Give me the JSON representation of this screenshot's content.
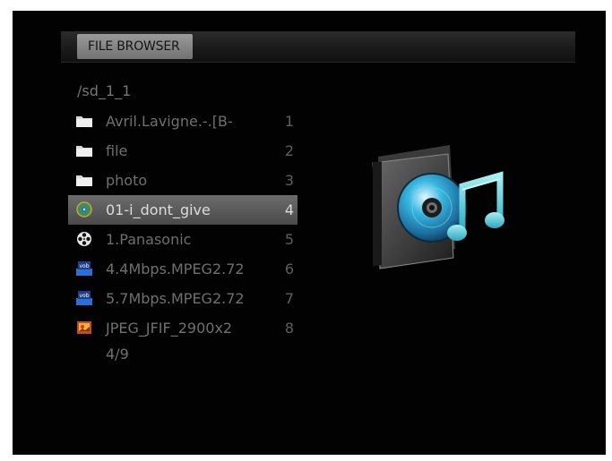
{
  "header": {
    "title": "FILE BROWSER"
  },
  "path": "/sd_1_1",
  "files": [
    {
      "name": "Avril.Lavigne.-.[B-",
      "index": "1",
      "icon": "folder-icon"
    },
    {
      "name": "file",
      "index": "2",
      "icon": "folder-icon"
    },
    {
      "name": "photo",
      "index": "3",
      "icon": "folder-icon"
    },
    {
      "name": "01-i_dont_give",
      "index": "4",
      "icon": "music-file-icon",
      "selected": true
    },
    {
      "name": "1.Panasonic",
      "index": "5",
      "icon": "film-reel-icon"
    },
    {
      "name": "4.4Mbps.MPEG2.72",
      "index": "6",
      "icon": "vob-video-icon"
    },
    {
      "name": "5.7Mbps.MPEG2.72",
      "index": "7",
      "icon": "vob-video-icon"
    },
    {
      "name": "JPEG_JFIF_2900x2",
      "index": "8",
      "icon": "jpeg-image-icon"
    }
  ],
  "page_count": "4/9",
  "preview": {
    "icon": "music-cd-icon"
  },
  "colors": {
    "background": "#020202",
    "selection": "#5b5b5b",
    "text": "#6f6f6f",
    "cd_blue": "#2fb3d8",
    "note_cyan": "#6fd6e0"
  }
}
